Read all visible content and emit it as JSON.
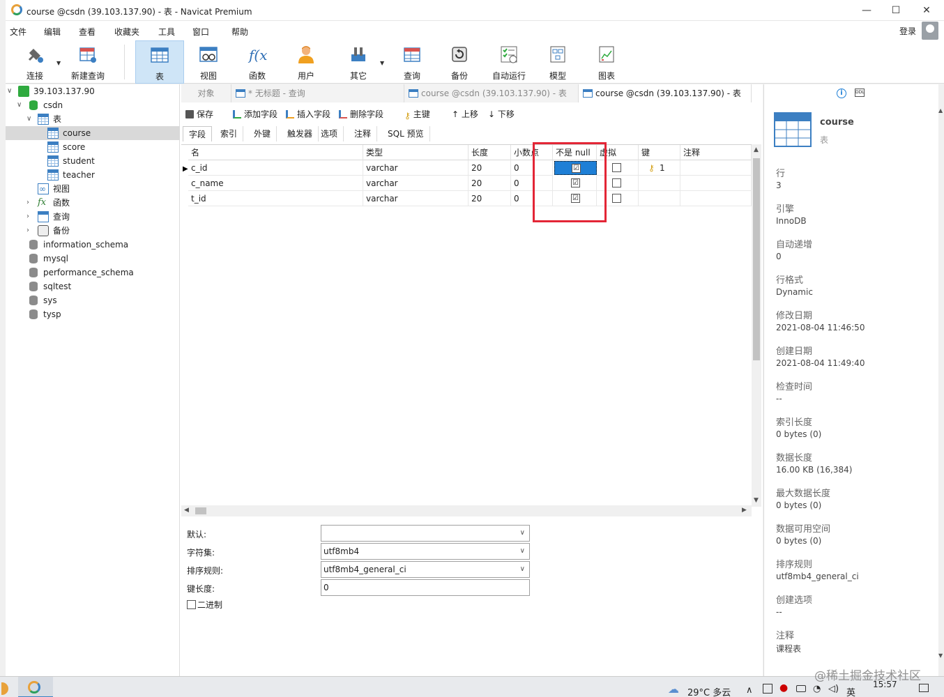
{
  "window": {
    "title": "course @csdn (39.103.137.90) - 表 - Navicat Premium",
    "minimize": "—",
    "maximize": "☐",
    "close": "✕"
  },
  "menu": [
    "文件",
    "编辑",
    "查看",
    "收藏夹",
    "工具",
    "窗口",
    "帮助"
  ],
  "login_label": "登录",
  "toolbar": [
    "连接",
    "新建查询",
    "表",
    "视图",
    "函数",
    "用户",
    "其它",
    "查询",
    "备份",
    "自动运行",
    "模型",
    "图表"
  ],
  "tree": {
    "connection": "39.103.137.90",
    "database": "csdn",
    "tables_group": "表",
    "tables": [
      "course",
      "score",
      "student",
      "teacher"
    ],
    "groups": [
      "视图",
      "函数",
      "查询",
      "备份"
    ],
    "other_dbs": [
      "information_schema",
      "mysql",
      "performance_schema",
      "sqltest",
      "sys",
      "tysp"
    ]
  },
  "tabs": [
    "对象",
    "* 无标题 - 查询",
    "course @csdn (39.103.137.90) - 表",
    "course @csdn (39.103.137.90) - 表"
  ],
  "subtoolbar": [
    "保存",
    "添加字段",
    "插入字段",
    "删除字段",
    "主键",
    "上移",
    "下移"
  ],
  "field_tabs": [
    "字段",
    "索引",
    "外键",
    "触发器",
    "选项",
    "注释",
    "SQL 预览"
  ],
  "grid": {
    "headers": [
      "名",
      "类型",
      "长度",
      "小数点",
      "不是 null",
      "虚拟",
      "键",
      "注释"
    ],
    "rows": [
      {
        "name": "c_id",
        "type": "varchar",
        "length": "20",
        "decimal": "0",
        "not_null": "☑",
        "virtual": "",
        "key": "1"
      },
      {
        "name": "c_name",
        "type": "varchar",
        "length": "20",
        "decimal": "0",
        "not_null": "☑",
        "virtual": "",
        "key": ""
      },
      {
        "name": "t_id",
        "type": "varchar",
        "length": "20",
        "decimal": "0",
        "not_null": "☑",
        "virtual": "",
        "key": ""
      }
    ]
  },
  "properties": {
    "default_label": "默认:",
    "default_value": "",
    "charset_label": "字符集:",
    "charset_value": "utf8mb4",
    "collation_label": "排序规则:",
    "collation_value": "utf8mb4_general_ci",
    "keylen_label": "键长度:",
    "keylen_value": "0",
    "binary_label": "二进制"
  },
  "info": {
    "name": "course",
    "kind": "表",
    "items": [
      {
        "label": "行",
        "value": "3"
      },
      {
        "label": "引擎",
        "value": "InnoDB"
      },
      {
        "label": "自动递增",
        "value": "0"
      },
      {
        "label": "行格式",
        "value": "Dynamic"
      },
      {
        "label": "修改日期",
        "value": "2021-08-04 11:46:50"
      },
      {
        "label": "创建日期",
        "value": "2021-08-04 11:49:40"
      },
      {
        "label": "检查时间",
        "value": "--"
      },
      {
        "label": "索引长度",
        "value": "0 bytes (0)"
      },
      {
        "label": "数据长度",
        "value": "16.00 KB (16,384)"
      },
      {
        "label": "最大数据长度",
        "value": "0 bytes (0)"
      },
      {
        "label": "数据可用空间",
        "value": "0 bytes (0)"
      },
      {
        "label": "排序规则",
        "value": "utf8mb4_general_ci"
      },
      {
        "label": "创建选项",
        "value": "--"
      },
      {
        "label": "注释",
        "value": "课程表"
      }
    ]
  },
  "taskbar": {
    "weather": "29°C  多云",
    "ime": "英",
    "time": "15:57",
    "watermark": "@稀土掘金技术社区"
  },
  "colors": {
    "accent": "#1e7fd6",
    "highlight": "#e32636",
    "selected_tool": "#cfe5f7"
  }
}
